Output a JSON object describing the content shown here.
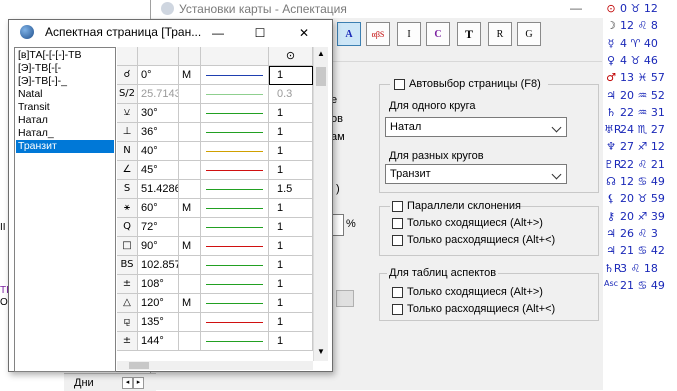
{
  "bg_window": {
    "title": "Установки карты - Аспектация",
    "min_glyph": "—",
    "toolbar": [
      {
        "icon": "aspect-grid-icon",
        "glyph": "▦",
        "selected": false
      },
      {
        "icon": "aspect-selection-icon",
        "glyph": "A",
        "selected": true
      },
      {
        "icon": "aspect-symbols-icon",
        "glyph": "αβS",
        "selected": false
      },
      {
        "icon": "table-icon",
        "glyph": "I",
        "selected": false
      },
      {
        "icon": "colors-icon",
        "glyph": "C",
        "selected": false
      },
      {
        "icon": "font-icon",
        "glyph": "T",
        "selected": false
      },
      {
        "icon": "ruler-icon",
        "glyph": "R",
        "selected": false
      },
      {
        "icon": "guide-icon",
        "glyph": "G",
        "selected": false
      }
    ],
    "auto_page_label": "Автовыбор страницы  (F8)",
    "one_circle_label": "Для одного круга",
    "one_circle_value": "Натал",
    "diff_circles_label": "Для разных кругов",
    "diff_circles_value": "Транзит",
    "declination_group": "Параллели склонения",
    "converging_label": "Только сходящиеся  (Alt+>)",
    "diverging_label": "Только расходящиеся (Alt+<)",
    "tables_group": "Для таблиц аспектов",
    "converging2_label": "Только сходящиеся  (Alt+>)",
    "diverging2_label": "Только расходящиеся (Alt+<)",
    "partial_e": "е",
    "partial_ov": "ов",
    "partial_am": "ам",
    "partial_paren": ")",
    "percent": "%",
    "cut_ii": "II",
    "cut_ti": "TI",
    "cut_os": "Os",
    "bottom_tab": "Дни"
  },
  "front_window": {
    "title": "Аспектная страница [Тран...",
    "min_glyph": "—",
    "max_glyph": "☐",
    "close_glyph": "✕",
    "list": [
      "[в]ТА[-[-[-]-ТВ",
      "[Э]-ТВ[-[-",
      "[Э]-ТВ[-]-_",
      "Natal",
      "Transit",
      "Натал",
      "Натал_",
      "Транзит"
    ],
    "selected_index": 7,
    "orb_header": "⊙",
    "rows": [
      {
        "sym": "☌",
        "deg": "0°",
        "m": "M",
        "color": "#1f3fb0",
        "orb": "1",
        "dim": false
      },
      {
        "sym": "S/2",
        "deg": "25.7143",
        "m": "",
        "color": "#8fcf8f",
        "orb": "0.3",
        "dim": true
      },
      {
        "sym": "⚺",
        "deg": "30°",
        "m": "",
        "color": "#22a022",
        "orb": "1",
        "dim": false
      },
      {
        "sym": "⊥",
        "deg": "36°",
        "m": "",
        "color": "#22a022",
        "orb": "1",
        "dim": false
      },
      {
        "sym": "N",
        "deg": "40°",
        "m": "",
        "color": "#d0a000",
        "orb": "1",
        "dim": false
      },
      {
        "sym": "∠",
        "deg": "45°",
        "m": "",
        "color": "#d01010",
        "orb": "1",
        "dim": false
      },
      {
        "sym": "S",
        "deg": "51.4286",
        "m": "",
        "color": "#22a022",
        "orb": "1.5",
        "dim": false
      },
      {
        "sym": "⚹",
        "deg": "60°",
        "m": "M",
        "color": "#22a022",
        "orb": "1",
        "dim": false
      },
      {
        "sym": "Q",
        "deg": "72°",
        "m": "",
        "color": "#22a022",
        "orb": "1",
        "dim": false
      },
      {
        "sym": "□",
        "deg": "90°",
        "m": "M",
        "color": "#d01010",
        "orb": "1",
        "dim": false
      },
      {
        "sym": "BS",
        "deg": "102.857",
        "m": "",
        "color": "#22a022",
        "orb": "1",
        "dim": false
      },
      {
        "sym": "±",
        "deg": "108°",
        "m": "",
        "color": "#22a022",
        "orb": "1",
        "dim": false
      },
      {
        "sym": "△",
        "deg": "120°",
        "m": "M",
        "color": "#22a022",
        "orb": "1",
        "dim": false
      },
      {
        "sym": "⚼",
        "deg": "135°",
        "m": "",
        "color": "#d01010",
        "orb": "1",
        "dim": false
      },
      {
        "sym": "±",
        "deg": "144°",
        "m": "",
        "color": "#22a022",
        "orb": "1",
        "dim": false
      }
    ]
  },
  "astro_column": [
    {
      "sym": "⊙",
      "val": "0 ♉ 12",
      "sym_color": "#c00000"
    },
    {
      "sym": "☽",
      "val": "12 ♌ 8",
      "sym_color": "#333333"
    },
    {
      "sym": "☿",
      "val": "4 ♈ 40",
      "sym_color": "#1a28b8"
    },
    {
      "sym": "♀",
      "val": "4 ♉ 46",
      "sym_color": "#1a28b8"
    },
    {
      "sym": "♂",
      "val": "13 ♓ 57",
      "sym_color": "#c00000"
    },
    {
      "sym": "♃",
      "val": "20 ♒ 52",
      "sym_color": "#1a28b8"
    },
    {
      "sym": "♄",
      "val": "22 ♒ 31",
      "sym_color": "#1a28b8"
    },
    {
      "sym": "♅R",
      "val": "24 ♏ 27",
      "sym_color": "#1a28b8"
    },
    {
      "sym": "♆",
      "val": "27 ♐ 12",
      "sym_color": "#1a28b8"
    },
    {
      "sym": "♇R",
      "val": "22 ♌ 21",
      "sym_color": "#1a28b8"
    },
    {
      "sym": "☊",
      "val": "12 ♋ 49",
      "sym_color": "#1a28b8"
    },
    {
      "sym": "⚸",
      "val": "20 ♉ 59",
      "sym_color": "#1a28b8"
    },
    {
      "sym": "⚷",
      "val": "20 ♐ 39",
      "sym_color": "#1a28b8"
    },
    {
      "sym": "♃",
      "val": "26 ♌ 3",
      "sym_color": "#1a28b8"
    },
    {
      "sym": "♃",
      "val": "21 ♋ 42",
      "sym_color": "#1a28b8"
    },
    {
      "sym": "♄R",
      "val": "3 ♌ 18",
      "sym_color": "#1a28b8"
    },
    {
      "sym": "Asc",
      "val": "21 ♋ 49",
      "sym_color": "#1a28b8"
    }
  ]
}
